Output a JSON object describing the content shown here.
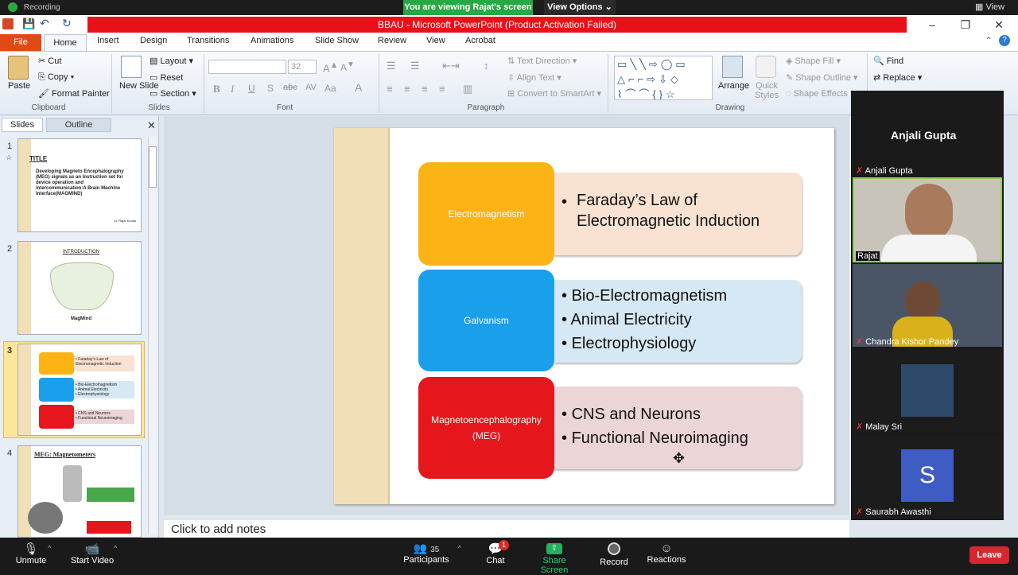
{
  "zoom": {
    "recording": "Recording",
    "viewing_banner": "You are viewing Rajat's screen",
    "view_options": "View Options",
    "view_top": "View",
    "bottom": {
      "unmute": "Unmute",
      "start_video": "Start Video",
      "participants": "Participants",
      "participants_count": "35",
      "chat": "Chat",
      "chat_badge": "1",
      "share_screen": "Share Screen",
      "record": "Record",
      "reactions": "Reactions",
      "leave": "Leave"
    },
    "gallery": {
      "speaker_name": "Anjali Gupta",
      "tiles": [
        {
          "name": "Anjali Gupta"
        },
        {
          "name": "Rajat"
        },
        {
          "name": "Chandra Kishor Pandey"
        },
        {
          "name": "Malay Sri"
        },
        {
          "name": "Saurabh Awasthi",
          "initial": "S"
        }
      ]
    }
  },
  "ppt": {
    "title": "BBAU - Microsoft PowerPoint (Product Activation Failed)",
    "tabs": [
      "File",
      "Home",
      "Insert",
      "Design",
      "Transitions",
      "Animations",
      "Slide Show",
      "Review",
      "View",
      "Acrobat"
    ],
    "clipboard": {
      "paste": "Paste",
      "cut": "Cut",
      "copy": "Copy",
      "format_painter": "Format Painter",
      "group": "Clipboard"
    },
    "slides_group": {
      "new_slide": "New Slide",
      "layout": "Layout",
      "reset": "Reset",
      "section": "Section",
      "group": "Slides"
    },
    "font": {
      "size": "32",
      "group": "Font"
    },
    "paragraph": {
      "text_direction": "Text Direction",
      "align_text": "Align Text",
      "convert": "Convert to SmartArt",
      "group": "Paragraph"
    },
    "drawing": {
      "arrange": "Arrange",
      "quick_styles": "Quick Styles",
      "shape_fill": "Shape Fill",
      "shape_outline": "Shape Outline",
      "shape_effects": "Shape Effects",
      "group": "Drawing"
    },
    "editing": {
      "find": "Find",
      "replace": "Replace"
    },
    "panel_tabs": {
      "slides": "Slides",
      "outline": "Outline"
    },
    "thumbnails": [
      {
        "num": "1",
        "heading": "TITLE",
        "body": "Developing Magneto Encephalography (MEG) signals as an Instruction set for device operation and intercommunication:A Brain Machine Interface(MAGMIND)",
        "author": "Dr. Rajat Kumar"
      },
      {
        "num": "2",
        "heading": "INTRODUCTION",
        "caption": "MagMind"
      },
      {
        "num": "3"
      },
      {
        "num": "4",
        "heading": "MEG: Magnetometers"
      }
    ],
    "slide": {
      "rows": [
        {
          "label": "Electromagnetism",
          "bullets": [
            "Faraday’s Law of Electromagnetic Induction"
          ]
        },
        {
          "label": "Galvanism",
          "bullets": [
            "Bio-Electromagnetism",
            "Animal Electricity",
            "Electrophysiology"
          ]
        },
        {
          "label": "Magnetoencephalography (MEG)",
          "bullets": [
            "CNS and Neurons",
            "Functional Neuroimaging"
          ]
        }
      ]
    },
    "notes_placeholder": "Click to add notes",
    "colors": {
      "row1": "#fbb316",
      "row2": "#1aa0ea",
      "row3": "#e5161c",
      "band1": "#f9e2d2",
      "band2": "#d6e8f3",
      "band3": "#ecd5d7"
    }
  }
}
